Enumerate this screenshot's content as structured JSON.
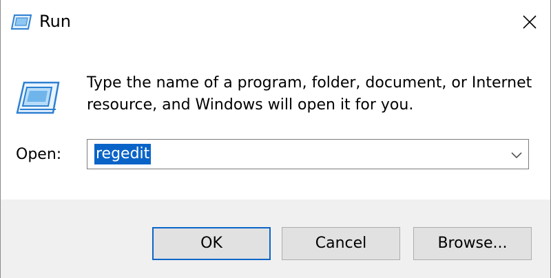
{
  "window": {
    "title": "Run",
    "icon": "run-icon"
  },
  "titlebar": {
    "close_icon": "close-icon"
  },
  "content": {
    "description": "Type the name of a program, folder, document, or Internet resource, and Windows will open it for you.",
    "open_label": "Open:",
    "open_value": "regedit"
  },
  "buttons": {
    "ok": "OK",
    "cancel": "Cancel",
    "browse": "Browse..."
  },
  "colors": {
    "selection": "#0a64c8",
    "footer_bg": "#f0f0f0",
    "button_bg": "#e1e1e1"
  }
}
